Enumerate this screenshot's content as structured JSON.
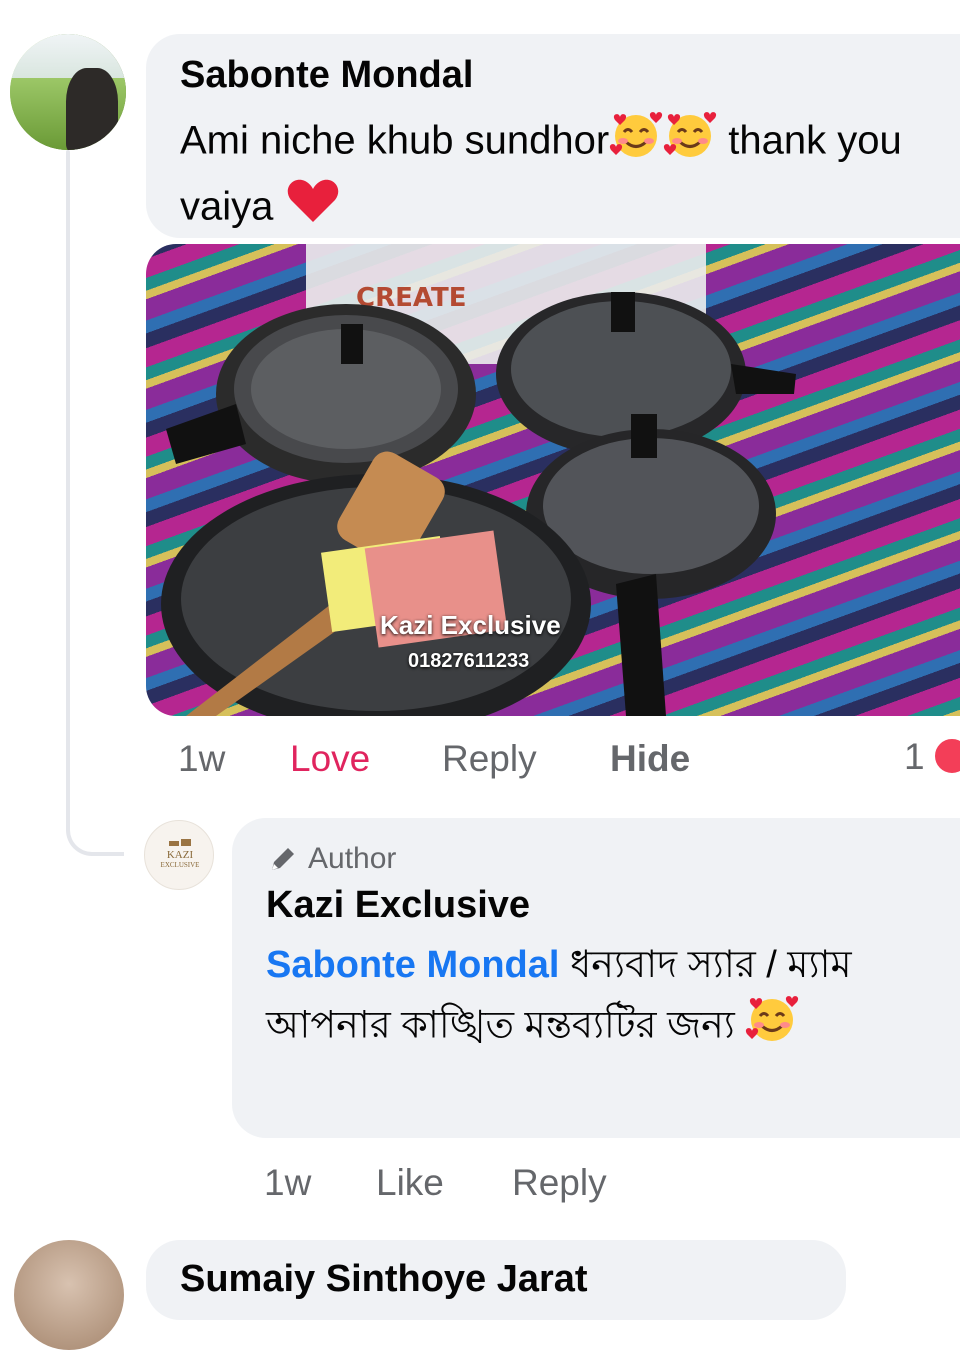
{
  "comment": {
    "author": "Sabonte Mondal",
    "text_a": "Ami niche khub sundhor",
    "text_b": " thank you vaiya ",
    "emojis": [
      "smiling-face-with-hearts",
      "smiling-face-with-hearts",
      "red-heart"
    ],
    "photo": {
      "watermark_name": "Kazi Exclusive",
      "watermark_phone": "01827611233"
    },
    "actions": {
      "time": "1w",
      "love": "Love",
      "reply": "Reply",
      "hide": "Hide"
    },
    "reaction_count": "1"
  },
  "reply": {
    "badge": "Author",
    "author": "Kazi Exclusive",
    "avatar_text_top": "KAZI",
    "avatar_text_bottom": "EXCLUSIVE",
    "mention": "Sabonte Mondal",
    "text": " ধন্যবাদ স্যার / ম্যাম আপনার কাঙ্খিত মন্তব্যটির জন্য ",
    "emoji": "smiling-face-with-hearts",
    "actions": {
      "time": "1w",
      "like": "Like",
      "reply": "Reply"
    }
  },
  "next_comment": {
    "author": "Sumaiy Sinthoye Jarat"
  },
  "colors": {
    "bubble": "#f0f2f5",
    "mention": "#1877f2",
    "love": "#e0245e",
    "meta": "#65676b"
  }
}
